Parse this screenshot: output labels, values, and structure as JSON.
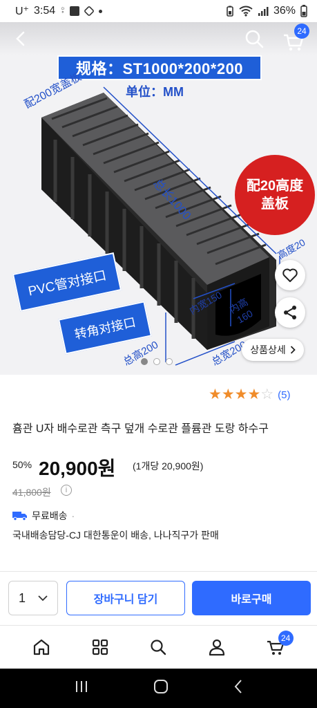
{
  "status_bar": {
    "carrier": "U⁺",
    "time": "3:54",
    "battery": "36%"
  },
  "header": {
    "cart_count": "24"
  },
  "product_image": {
    "spec": "规格：ST1000*200*200",
    "unit": "单位：MM",
    "cover_label": "配200宽盖板",
    "length_label": "总长1000",
    "red_badge_line1": "配20高度",
    "red_badge_line2": "盖板",
    "height20_label": "高度20",
    "pvc_tag": "PVC管对接口",
    "corner_tag": "转角对接口",
    "inner_width": "内宽150",
    "inner_height_line1": "内高",
    "inner_height_line2": "160",
    "total_height": "总高200",
    "total_width": "总宽200",
    "detail_button": "상품상세",
    "carousel_total": 3,
    "carousel_active": 0
  },
  "rating": {
    "stars": 4,
    "max": 5,
    "review_count": "(5)"
  },
  "product": {
    "title": "흄관 U자 배수로관 측구 덮개 수로관 플륨관 도랑 하수구",
    "discount": "50%",
    "price": "20,900원",
    "unit_price": "(1개당 20,900원)",
    "original_price": "41,800원",
    "shipping_free": "무료배송",
    "shipping_sep": "·",
    "shipping_detail": "국내배송담당-CJ 대한통운이 배송, 나나직구가 판매"
  },
  "purchase": {
    "quantity": "1",
    "cart_button": "장바구니 담기",
    "buy_button": "바로구매"
  },
  "tabbar": {
    "cart_count": "24"
  },
  "colors": {
    "accent": "#2f6bff",
    "star": "#f08c2a",
    "badge_red": "#d62020",
    "banner_blue": "#1f5fd8"
  }
}
